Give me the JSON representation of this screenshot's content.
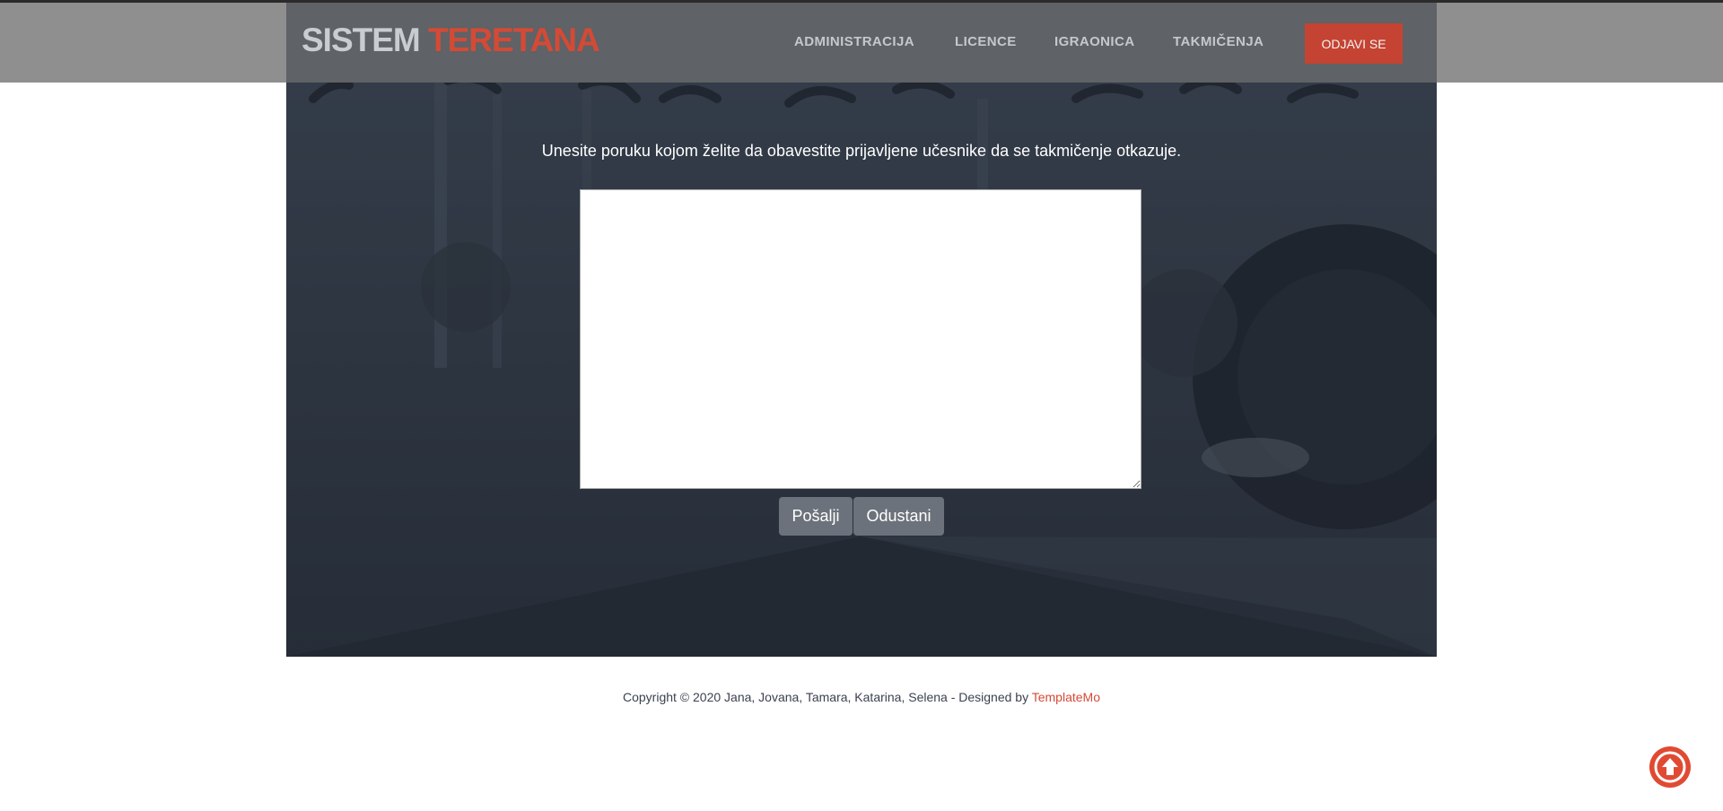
{
  "header": {
    "logo_part1": "SISTEM",
    "logo_part2": "TERETANA",
    "nav": [
      "ADMINISTRACIJA",
      "LICENCE",
      "IGRAONICA",
      "TAKMIČENJA"
    ],
    "logout_label": "ODJAVI SE"
  },
  "main": {
    "prompt": "Unesite poruku kojom želite da obavestite prijavljene učesnike da se takmičenje otkazuje.",
    "message_value": "",
    "send_label": "Pošalji",
    "cancel_label": "Odustani"
  },
  "footer": {
    "text": "Copyright © 2020 Jana, Jovana, Tamara, Katarina, Selena - Designed by",
    "link": "TemplateMo"
  },
  "icons": {
    "scroll_top": "arrow-up-circle-icon"
  },
  "colors": {
    "accent": "#d44a35",
    "hero_bg": "#2e3744",
    "header_bg": "#808080"
  }
}
